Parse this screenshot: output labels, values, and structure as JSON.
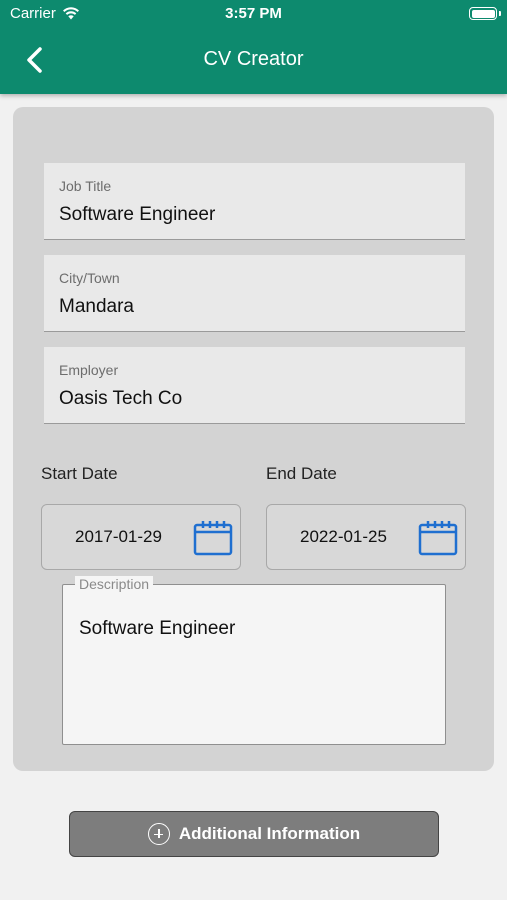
{
  "status_bar": {
    "carrier": "Carrier",
    "time": "3:57 PM"
  },
  "nav": {
    "title": "CV Creator",
    "back_icon": "chevron-left-icon"
  },
  "form": {
    "job_title": {
      "label": "Job Title",
      "value": "Software Engineer"
    },
    "city": {
      "label": "City/Town",
      "value": "Mandara"
    },
    "employer": {
      "label": "Employer",
      "value": "Oasis Tech Co"
    },
    "start_date": {
      "label": "Start Date",
      "value": "2017-01-29",
      "icon": "calendar-icon"
    },
    "end_date": {
      "label": "End Date",
      "value": "2022-01-25",
      "icon": "calendar-icon"
    },
    "description": {
      "label": "Description",
      "value": "Software Engineer"
    }
  },
  "footer": {
    "button_label": "Additional Information",
    "button_icon": "plus-circle-icon"
  },
  "colors": {
    "header": "#0d8a6e",
    "calendar_icon": "#1f6fd0",
    "card": "#d3d3d3"
  }
}
